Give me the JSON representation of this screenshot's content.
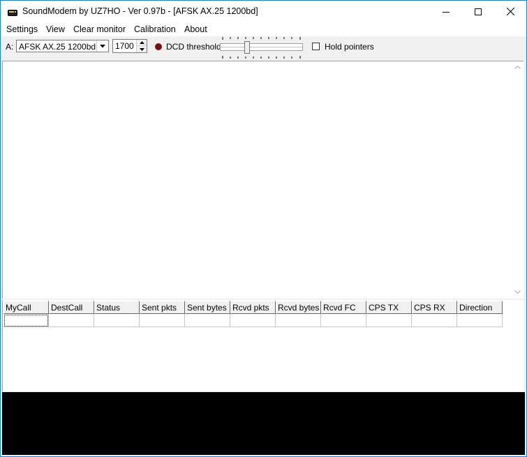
{
  "window": {
    "title": "SoundModem by UZ7HO - Ver 0.97b - [AFSK AX.25 1200bd]"
  },
  "menu": {
    "items": [
      "Settings",
      "View",
      "Clear monitor",
      "Calibration",
      "About"
    ]
  },
  "toolbar": {
    "channel_label": "A:",
    "mode_value": "AFSK AX.25 1200bd",
    "frequency_value": "1700",
    "dcd_label": "DCD threshold",
    "dcd_led_color": "#7a1010",
    "hold_pointers_label": "Hold pointers",
    "hold_pointers_checked": false
  },
  "table": {
    "columns": [
      "MyCall",
      "DestCall",
      "Status",
      "Sent pkts",
      "Sent bytes",
      "Rcvd pkts",
      "Rcvd bytes",
      "Rcvd FC",
      "CPS TX",
      "CPS RX",
      "Direction"
    ],
    "rows": [
      [
        "",
        "",
        "",
        "",
        "",
        "",
        "",
        "",
        "",
        "",
        ""
      ]
    ]
  },
  "colors": {
    "window_border": "#1883d7",
    "background": "#f0f0f0",
    "waterfall": "#000000"
  }
}
